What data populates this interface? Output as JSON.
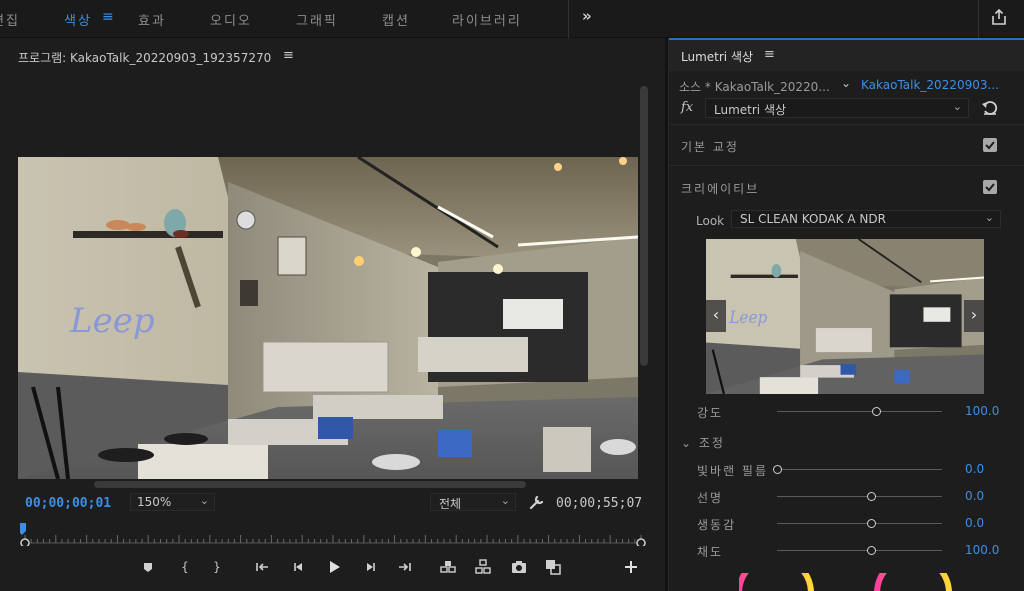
{
  "workspace_tabs": {
    "edit": "편집",
    "color": "색상",
    "effects": "효과",
    "audio": "오디오",
    "graphics": "그래픽",
    "captions": "캡션",
    "libraries": "라이브러리",
    "more": "»"
  },
  "program": {
    "title": "프로그램: KakaoTalk_20220903_192357270",
    "menu": "≡",
    "timecode_current": "00;00;00;01",
    "zoom": "150%",
    "resolution": "전체",
    "timecode_duration": "00;00;55;07",
    "playhead_position": 0.0
  },
  "lumetri": {
    "title": "Lumetri 색상",
    "menu": "≡",
    "source_label": "소스 * KakaoTalk_20220...",
    "sequence_label": "KakaoTalk_20220903...",
    "fx_label": "fx",
    "effect_select": "Lumetri 색상",
    "sections": {
      "basic": "기본 교정",
      "creative": "크리에이티브"
    },
    "basic_checked": true,
    "creative_checked": true,
    "look_label": "Look",
    "look_value": "SL CLEAN KODAK A NDR",
    "intensity": {
      "label": "강도",
      "value": "100.0",
      "fraction": 0.6
    },
    "adjustments_header": "조정",
    "adjustments": [
      {
        "label": "빛바랜 필름",
        "value": "0.0",
        "fraction": 0.0
      },
      {
        "label": "선명",
        "value": "0.0",
        "fraction": 0.57
      },
      {
        "label": "생동감",
        "value": "0.0",
        "fraction": 0.57
      },
      {
        "label": "채도",
        "value": "100.0",
        "fraction": 0.57
      }
    ]
  },
  "colors": {
    "accent": "#3d8fe6",
    "panel_bg": "#1d1d1d",
    "text": "#b8b8b8"
  },
  "icons": [
    "menu-icon",
    "share-icon",
    "wrench-icon",
    "chevron-down-icon",
    "reset-icon",
    "checkbox-icon",
    "marker-icon",
    "mark-in-icon",
    "mark-out-icon",
    "go-to-in-icon",
    "step-back-icon",
    "play-icon",
    "step-forward-icon",
    "go-to-out-icon",
    "lift-icon",
    "extract-icon",
    "camera-icon",
    "comparison-icon",
    "add-button-icon"
  ]
}
